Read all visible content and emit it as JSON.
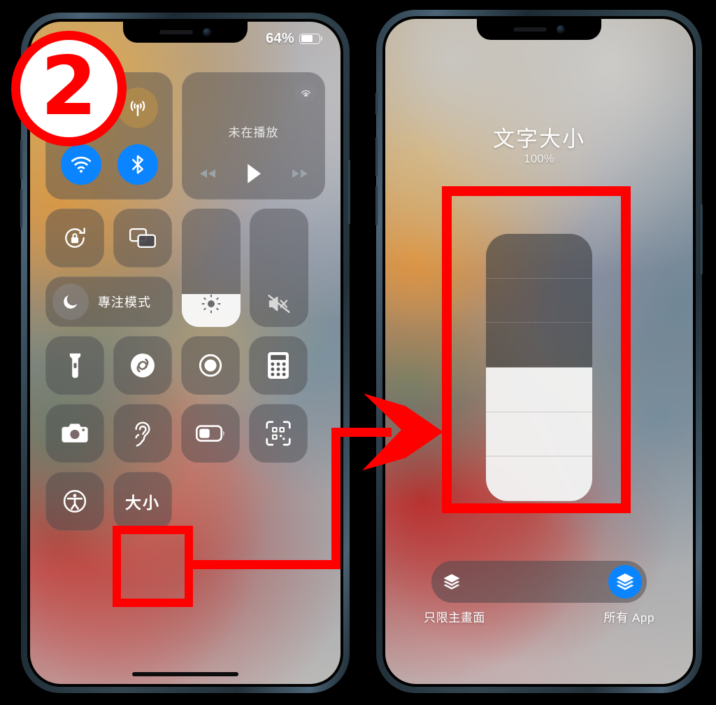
{
  "annotation": {
    "step_badge": "2",
    "badge_color": "#ff0000",
    "highlight_color": "#ff0000"
  },
  "left_phone": {
    "status_bar": {
      "battery_percent": "64%",
      "battery_level": 64,
      "battery_icon": "battery-icon"
    },
    "control_center": {
      "connectivity": [
        {
          "name": "airplane-mode",
          "icon": "airplane-icon",
          "state": "off"
        },
        {
          "name": "cellular-data",
          "icon": "cellular-antenna-icon",
          "state": "off"
        },
        {
          "name": "wifi",
          "icon": "wifi-icon",
          "state": "on"
        },
        {
          "name": "bluetooth",
          "icon": "bluetooth-icon",
          "state": "on"
        }
      ],
      "media": {
        "title": "未在播放",
        "airplay_icon": "airplay-icon",
        "controls": [
          "rewind-icon",
          "play-icon",
          "fastforward-icon"
        ]
      },
      "rotation_lock": {
        "label": "",
        "icon": "rotation-lock-icon"
      },
      "screen_mirroring": {
        "label": "",
        "icon": "screen-mirroring-icon"
      },
      "focus": {
        "label": "專注模式",
        "icon": "moon-icon"
      },
      "brightness": {
        "icon": "brightness-icon",
        "value": 28
      },
      "volume": {
        "icon": "mute-bell-icon",
        "value": 0
      },
      "shortcuts_row_1": [
        {
          "name": "flashlight",
          "icon": "flashlight-icon"
        },
        {
          "name": "shazam",
          "icon": "shazam-icon"
        },
        {
          "name": "screen-record",
          "icon": "screen-record-icon"
        },
        {
          "name": "calculator",
          "icon": "calculator-icon"
        }
      ],
      "shortcuts_row_2": [
        {
          "name": "camera",
          "icon": "camera-icon"
        },
        {
          "name": "hearing",
          "icon": "ear-icon"
        },
        {
          "name": "low-power-mode",
          "icon": "battery-low-power-icon"
        },
        {
          "name": "code-scanner",
          "icon": "qr-code-icon"
        }
      ],
      "shortcuts_row_3": [
        {
          "name": "accessibility-shortcuts",
          "icon": "accessibility-icon"
        },
        {
          "name": "text-size",
          "label": "大小",
          "highlighted": true
        }
      ]
    }
  },
  "right_phone": {
    "text_size_panel": {
      "title": "文字大小",
      "percent": "100%",
      "slider_segments_total": 6,
      "slider_segments_filled": 3,
      "scope_toggle": {
        "left_label": "只限主畫面",
        "right_label": "所有 App",
        "selected": "所有 App",
        "left_icon": "layers-icon",
        "right_icon": "layers-icon",
        "accent_color": "#0a84ff"
      }
    }
  }
}
